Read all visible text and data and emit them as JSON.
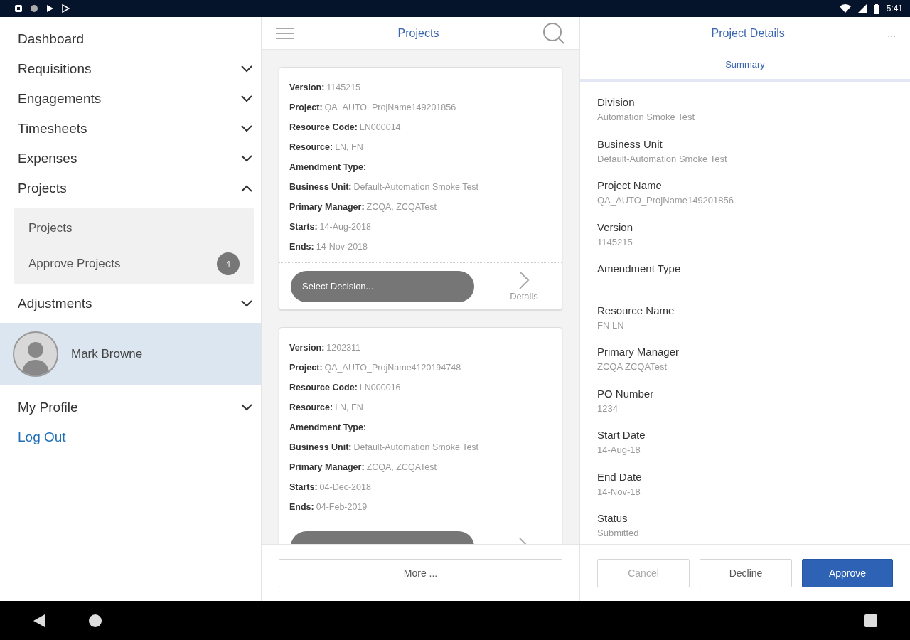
{
  "status_bar": {
    "time": "5:41"
  },
  "sidebar": {
    "menu": [
      {
        "label": "Dashboard",
        "kind": "plain"
      },
      {
        "label": "Requisitions",
        "kind": "expandable",
        "expanded": false
      },
      {
        "label": "Engagements",
        "kind": "expandable",
        "expanded": false
      },
      {
        "label": "Timesheets",
        "kind": "expandable",
        "expanded": false
      },
      {
        "label": "Expenses",
        "kind": "expandable",
        "expanded": false
      },
      {
        "label": "Projects",
        "kind": "expandable",
        "expanded": true,
        "children": [
          {
            "label": "Projects"
          },
          {
            "label": "Approve Projects",
            "badge": "4"
          }
        ]
      },
      {
        "label": "Adjustments",
        "kind": "expandable",
        "expanded": false
      }
    ],
    "user": {
      "name": "Mark Browne"
    },
    "account_menu": [
      {
        "label": "My Profile",
        "kind": "expandable",
        "expanded": false
      },
      {
        "label": "Log Out",
        "kind": "link"
      }
    ]
  },
  "projects": {
    "title": "Projects",
    "cards": [
      {
        "fields": [
          {
            "label": "Version:",
            "value": "1145215"
          },
          {
            "label": "Project:",
            "value": "QA_AUTO_ProjName149201856"
          },
          {
            "label": "Resource Code:",
            "value": "LN000014"
          },
          {
            "label": "Resource:",
            "value": "LN, FN"
          },
          {
            "label": "Amendment Type:"
          },
          {
            "label": "Business Unit:",
            "value": "Default-Automation Smoke Test"
          },
          {
            "label": "Primary Manager:",
            "value": "ZCQA, ZCQATest"
          },
          {
            "label": "Starts:",
            "value": "14-Aug-2018"
          },
          {
            "label": "Ends:",
            "value": "14-Nov-2018"
          }
        ],
        "decision": "Select Decision...",
        "details": "Details"
      },
      {
        "fields": [
          {
            "label": "Version:",
            "value": "1202311"
          },
          {
            "label": "Project:",
            "value": "QA_AUTO_ProjName4120194748"
          },
          {
            "label": "Resource Code:",
            "value": "LN000016"
          },
          {
            "label": "Resource:",
            "value": "LN, FN"
          },
          {
            "label": "Amendment Type:"
          },
          {
            "label": "Business Unit:",
            "value": "Default-Automation Smoke Test"
          },
          {
            "label": "Primary Manager:",
            "value": "ZCQA, ZCQATest"
          },
          {
            "label": "Starts:",
            "value": "04-Dec-2018"
          },
          {
            "label": "Ends:",
            "value": "04-Feb-2019"
          }
        ]
      }
    ],
    "more_button": "More ..."
  },
  "details": {
    "title": "Project Details",
    "menu": "...",
    "tabs": [
      {
        "label": "Summary",
        "selected": true
      }
    ],
    "fields": [
      {
        "label": "Division",
        "value": "Automation Smoke Test"
      },
      {
        "label": "Business Unit",
        "value": "Default-Automation Smoke Test"
      },
      {
        "label": "Project Name",
        "value": "QA_AUTO_ProjName149201856"
      },
      {
        "label": "Version",
        "value": "1145215"
      },
      {
        "label": "Amendment Type"
      },
      {
        "label": "Resource Name",
        "value": "FN LN"
      },
      {
        "label": "Primary Manager",
        "value": "ZCQA ZCQATest"
      },
      {
        "label": "PO Number",
        "value": "1234"
      },
      {
        "label": "Start Date",
        "value": "14-Aug-18"
      },
      {
        "label": "End Date",
        "value": "14-Nov-18"
      },
      {
        "label": "Status",
        "value": "Submitted"
      }
    ],
    "buttons": [
      {
        "label": "Cancel",
        "kind": "muted"
      },
      {
        "label": "Decline",
        "kind": "outline"
      },
      {
        "label": "Approve",
        "kind": "primary"
      }
    ]
  }
}
